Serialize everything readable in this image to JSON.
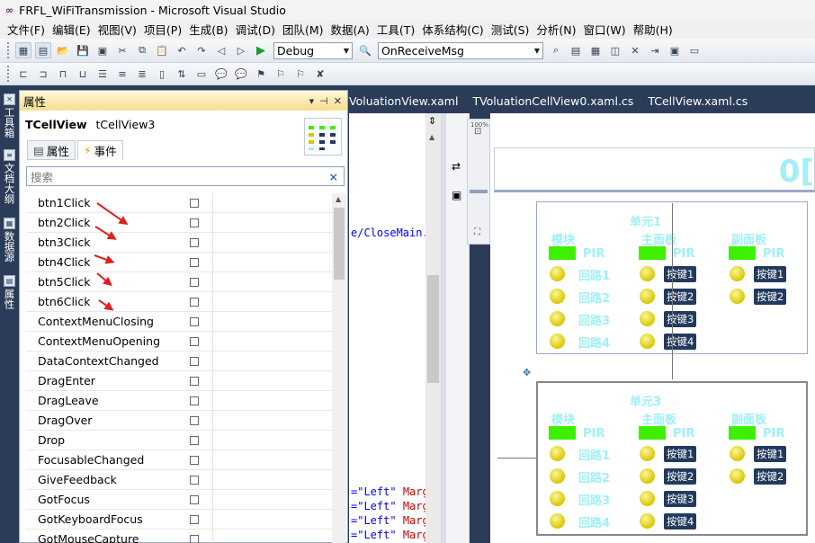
{
  "window": {
    "title": "FRFL_WiFiTransmission - Microsoft Visual Studio",
    "logo": "∞"
  },
  "menu": [
    "文件(F)",
    "编辑(E)",
    "视图(V)",
    "项目(P)",
    "生成(B)",
    "调试(D)",
    "团队(M)",
    "数据(A)",
    "工具(T)",
    "体系结构(C)",
    "测试(S)",
    "分析(N)",
    "窗口(W)",
    "帮助(H)"
  ],
  "toolbar": {
    "config": "Debug",
    "target": "OnReceiveMsg"
  },
  "left_tabs": [
    "工具箱",
    "文档大纲",
    "数据源",
    "属性"
  ],
  "properties": {
    "title": "属性",
    "type_name": "TCellView",
    "instance_name": "tCellView3",
    "tab_properties": "属性",
    "tab_events": "事件",
    "search_placeholder": "搜索",
    "search_clear": "×",
    "events": [
      "btn1Click",
      "btn2Click",
      "btn3Click",
      "btn4Click",
      "btn5Click",
      "btn6Click",
      "ContextMenuClosing",
      "ContextMenuOpening",
      "DataContextChanged",
      "DragEnter",
      "DragLeave",
      "DragOver",
      "Drop",
      "FocusableChanged",
      "GiveFeedback",
      "GotFocus",
      "GotKeyboardFocus",
      "GotMouseCapture"
    ]
  },
  "doc_tabs": [
    "VoluationView.xaml",
    "TVoluationCellView0.xaml.cs",
    "TCellView.xaml.cs"
  ],
  "code": {
    "line1": "e/CloseMain.",
    "attr_lines": [
      {
        "val": "=\"Left\"",
        "kw": "Marg"
      },
      {
        "val": "=\"Left\"",
        "kw": "Marg"
      },
      {
        "val": "=\"Left\"",
        "kw": "Marg"
      },
      {
        "val": "=\"Left\"",
        "kw": "Marg"
      }
    ]
  },
  "designer": {
    "zoom": "100%",
    "big_label": "0[",
    "units": [
      {
        "name": "单元1"
      },
      {
        "name": "单元3"
      }
    ],
    "col_module": "模块",
    "col_main": "主面板",
    "col_sub": "副面板",
    "pir": "PIR",
    "loops": [
      "回路1",
      "回路2",
      "回路3",
      "回路4"
    ],
    "keys_main": [
      "按键1",
      "按键2",
      "按键3",
      "按键4"
    ],
    "keys_sub": [
      "按键1",
      "按键2"
    ]
  },
  "colors": {
    "accent_cyan": "#9ff0f7",
    "pir_green": "#3cf000",
    "key_bg": "#223a5e",
    "arrow_red": "#e0201c",
    "chrome_dark": "#2b3c59"
  }
}
